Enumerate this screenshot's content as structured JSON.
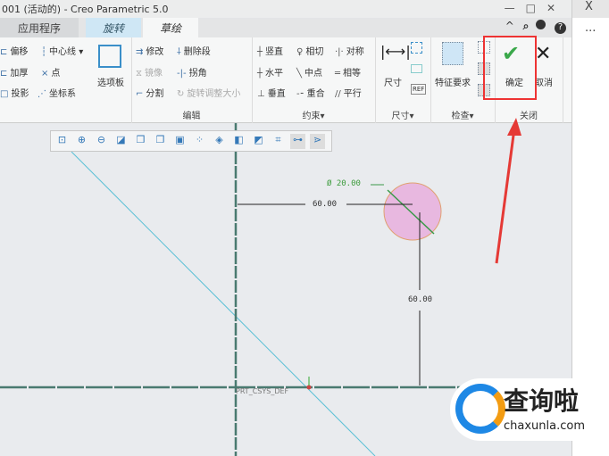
{
  "window": {
    "title": "001 (活动的) - Creo Parametric 5.0",
    "controls": [
      "—",
      "□",
      "✕"
    ]
  },
  "side_panel": {
    "close": "X",
    "more": "..."
  },
  "tabs": [
    {
      "label": "应用程序"
    },
    {
      "label": "旋转"
    },
    {
      "label": "草绘"
    }
  ],
  "quick_access": {
    "collapse": "^",
    "search": "⌕",
    "help": "?"
  },
  "ribbon": {
    "sketch": {
      "offset": "偏移",
      "thicken": "加厚",
      "project": "投影",
      "centerline": "中心线",
      "point": "点",
      "csys": "坐标系",
      "palette": "选项板"
    },
    "edit": {
      "modify": "修改",
      "delete_segment": "删除段",
      "mirror": "镜像",
      "corner": "拐角",
      "divide": "分割",
      "rotate_resize": "旋转调整大小",
      "label": "编辑"
    },
    "constrain": {
      "vertical": "竖直",
      "horizontal": "水平",
      "perpendicular": "垂直",
      "tangent": "相切",
      "midpoint": "中点",
      "coincident": "重合",
      "symmetric": "对称",
      "equal": "相等",
      "parallel": "平行",
      "label": "约束▾"
    },
    "dimension": {
      "dimension": "尺寸",
      "label": "尺寸▾"
    },
    "inspect": {
      "feature_req": "特征要求",
      "label": "检查▾"
    },
    "close": {
      "ok": "确定",
      "cancel": "取消",
      "label": "关闭"
    }
  },
  "sketch": {
    "diameter": "Ø 20.00",
    "horiz_dim": "60.00",
    "vert_dim": "60.00",
    "csys": "PRT_CSYS_DEF"
  },
  "watermark": {
    "name": "查询啦",
    "url": "chaxunla.com"
  }
}
